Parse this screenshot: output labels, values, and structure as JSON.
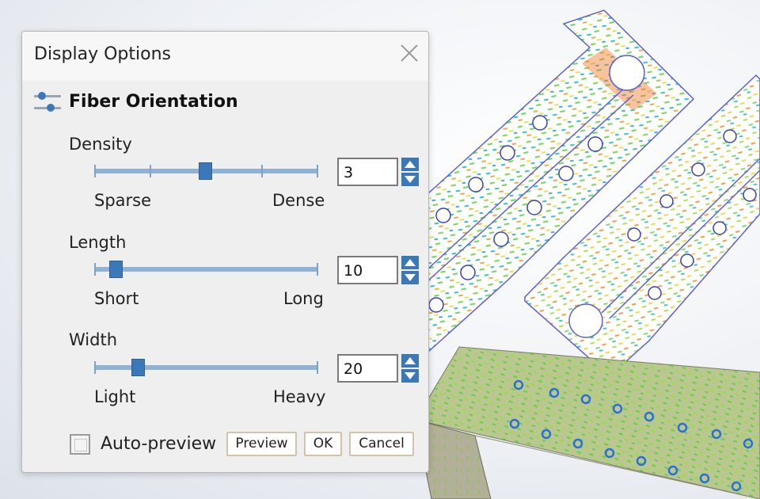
{
  "dialog": {
    "title": "Display Options",
    "close_icon": "close-icon",
    "section_icon": "sliders-icon",
    "section_title": "Fiber Orientation",
    "sliders": [
      {
        "label": "Density",
        "min_label": "Sparse",
        "max_label": "Dense",
        "value": "3"
      },
      {
        "label": "Length",
        "min_label": "Short",
        "max_label": "Long",
        "value": "10"
      },
      {
        "label": "Width",
        "min_label": "Light",
        "max_label": "Heavy",
        "value": "20"
      }
    ],
    "auto_preview_label": "Auto-preview",
    "auto_preview_checked": false,
    "buttons": {
      "preview": "Preview",
      "ok": "OK",
      "cancel": "Cancel"
    }
  },
  "theme": {
    "accent": "#3b78b8",
    "track": "#8fb2d6",
    "button_border": "#d2c4a8"
  }
}
